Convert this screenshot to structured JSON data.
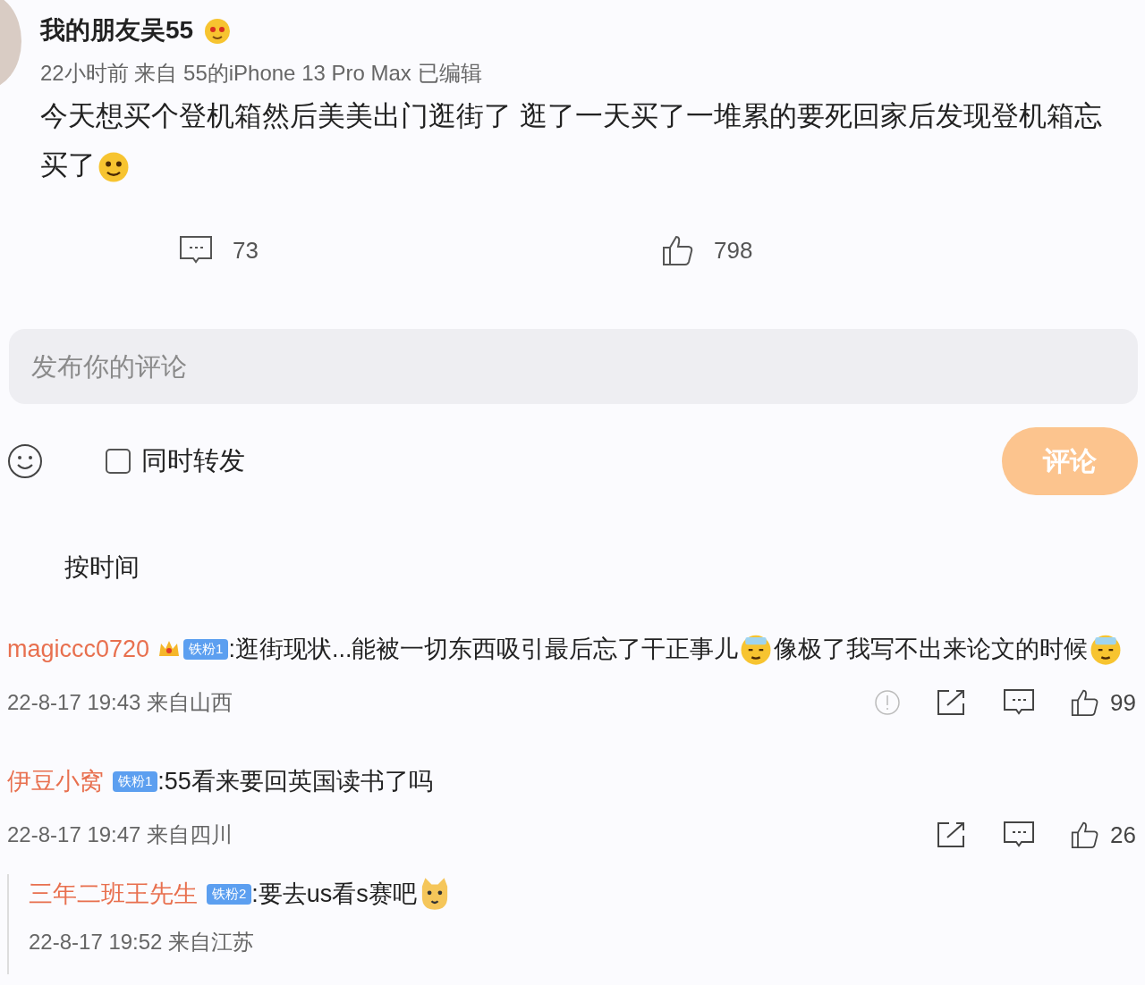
{
  "post": {
    "author": "我的朋友吴55",
    "meta": "22小时前  来自 55的iPhone 13 Pro Max 已编辑",
    "text_lines": [
      "今天想买个登机箱然后美美出门逛街了 逛了一天买了一堆累的要死回家后发现登机箱忘",
      "买了"
    ],
    "comments_count": "73",
    "likes_count": "798"
  },
  "composer": {
    "placeholder": "发布你的评论",
    "repost_label": "同时转发",
    "repost_checked": false,
    "submit": "评论"
  },
  "sort_label": "按时间",
  "comments": [
    {
      "user": "magiccc0720",
      "badge": "铁粉1",
      "content": [
        {
          "kind": "text",
          "text": ":逛街现状...能被一切东西吸引最后忘了干正事儿"
        },
        {
          "kind": "emoji"
        },
        {
          "kind": "text",
          "text": "像极了我写不出来论文的时候"
        },
        {
          "kind": "emoji"
        }
      ],
      "meta": "22-8-17 19:43 来自山西",
      "report": true,
      "likes": "99"
    },
    {
      "user": "伊豆小窝",
      "badge": "铁粉1",
      "content": [
        {
          "kind": "text",
          "text": ":55看来要回英国读书了吗"
        }
      ],
      "meta": "22-8-17 19:47 来自四川",
      "report": false,
      "likes": "26",
      "children": [
        {
          "user": "三年二班王先生",
          "badge": "铁粉2",
          "content": [
            {
              "kind": "text",
              "text": ":要去us看s赛吧"
            },
            {
              "kind": "emoji"
            }
          ],
          "meta": "22-8-17 19:52 来自江苏"
        }
      ]
    }
  ]
}
